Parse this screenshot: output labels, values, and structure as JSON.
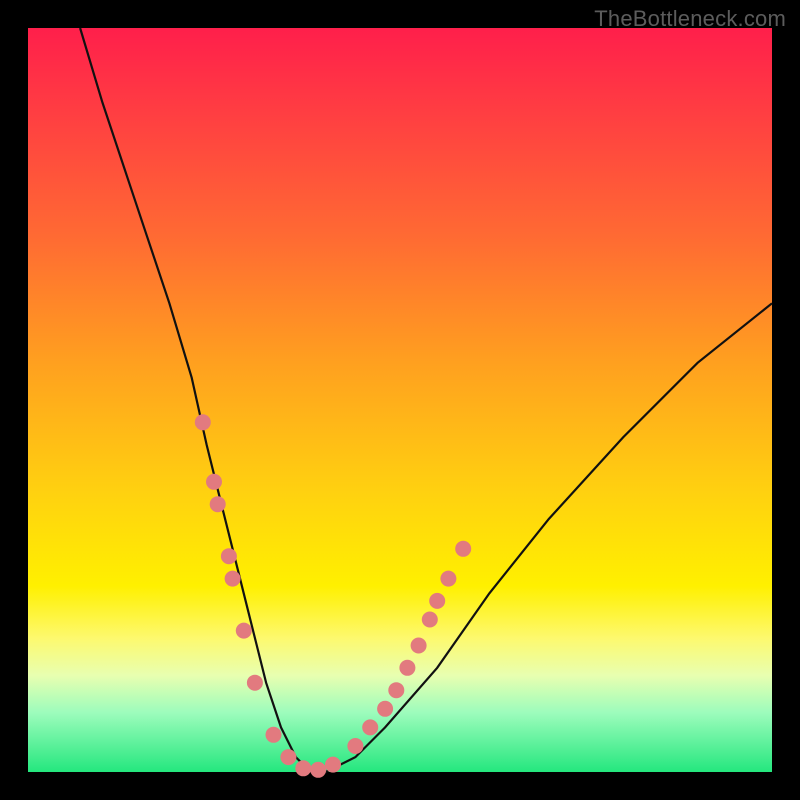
{
  "watermark": "TheBottleneck.com",
  "chart_data": {
    "type": "line",
    "title": "",
    "xlabel": "",
    "ylabel": "",
    "ylim": [
      0,
      100
    ],
    "xlim": [
      0,
      100
    ],
    "series": [
      {
        "name": "bottleneck-curve",
        "x": [
          7,
          10,
          13,
          16,
          19,
          22,
          24,
          26,
          28,
          30,
          32,
          34,
          36,
          38,
          40,
          44,
          48,
          55,
          62,
          70,
          80,
          90,
          100
        ],
        "y": [
          100,
          90,
          81,
          72,
          63,
          53,
          44,
          36,
          28,
          20,
          12,
          6,
          2,
          0,
          0,
          2,
          6,
          14,
          24,
          34,
          45,
          55,
          63
        ]
      }
    ],
    "markers": [
      {
        "x": 23.5,
        "y": 47
      },
      {
        "x": 25.0,
        "y": 39
      },
      {
        "x": 25.5,
        "y": 36
      },
      {
        "x": 27.0,
        "y": 29
      },
      {
        "x": 27.5,
        "y": 26
      },
      {
        "x": 29.0,
        "y": 19
      },
      {
        "x": 30.5,
        "y": 12
      },
      {
        "x": 33.0,
        "y": 5
      },
      {
        "x": 35.0,
        "y": 2
      },
      {
        "x": 37.0,
        "y": 0.5
      },
      {
        "x": 39.0,
        "y": 0.3
      },
      {
        "x": 41.0,
        "y": 1
      },
      {
        "x": 44.0,
        "y": 3.5
      },
      {
        "x": 46.0,
        "y": 6
      },
      {
        "x": 48.0,
        "y": 8.5
      },
      {
        "x": 49.5,
        "y": 11
      },
      {
        "x": 51.0,
        "y": 14
      },
      {
        "x": 52.5,
        "y": 17
      },
      {
        "x": 54.0,
        "y": 20.5
      },
      {
        "x": 55.0,
        "y": 23
      },
      {
        "x": 56.5,
        "y": 26
      },
      {
        "x": 58.5,
        "y": 30
      }
    ],
    "marker_color": "#e27a7f",
    "curve_color": "#111111"
  }
}
